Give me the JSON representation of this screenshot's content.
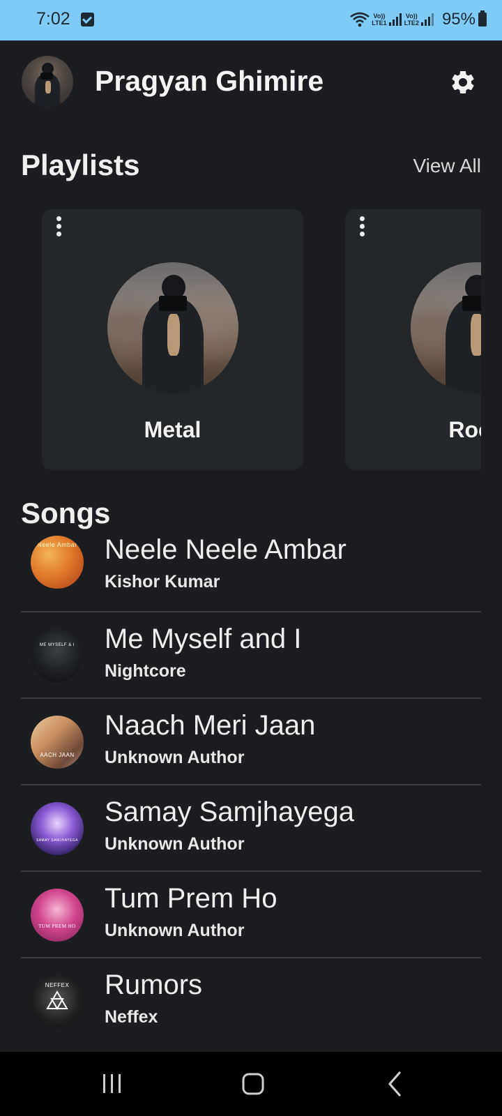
{
  "status_bar": {
    "time": "7:02",
    "lte1": "LTE1",
    "lte2": "LTE2",
    "volte": "Vo))",
    "battery": "95%"
  },
  "header": {
    "user_name": "Pragyan Ghimire",
    "settings_icon": "gear-icon"
  },
  "playlists": {
    "title": "Playlists",
    "view_all": "View All",
    "items": [
      {
        "name": "Metal"
      },
      {
        "name": "Rock"
      }
    ]
  },
  "songs": {
    "title": "Songs",
    "items": [
      {
        "title": "Neele Neele Ambar",
        "artist": "Kishor Kumar",
        "thumb_text": "Neele Ambar"
      },
      {
        "title": "Me Myself and I",
        "artist": "Nightcore",
        "thumb_text": "ME MYSELF & I"
      },
      {
        "title": "Naach Meri Jaan",
        "artist": "Unknown Author",
        "thumb_text": "AACH JAAN"
      },
      {
        "title": "Samay Samjhayega",
        "artist": "Unknown Author",
        "thumb_text": "SAMAY SAMJHAYEGA"
      },
      {
        "title": "Tum Prem Ho",
        "artist": "Unknown Author",
        "thumb_text": "TUM PREM HO"
      },
      {
        "title": "Rumors",
        "artist": "Neffex",
        "thumb_text": "NEFFEX"
      }
    ]
  },
  "colors": {
    "status_bar": "#7ecbf7",
    "background": "#1b1d20",
    "card": "#232729",
    "divider": "#3c3f42"
  },
  "nav": {
    "recents_icon": "recents-icon",
    "home_icon": "home-icon",
    "back_icon": "back-icon"
  }
}
